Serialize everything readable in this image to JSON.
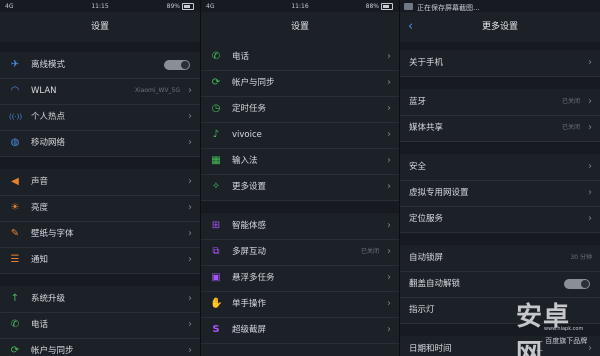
{
  "panel1": {
    "status": {
      "left": "4G",
      "time": "11:15",
      "battery": "89%"
    },
    "title": "设置",
    "items": [
      {
        "label": "离线模式",
        "icon": "airplane-icon",
        "color": "#4a90e2",
        "glyph": "✈"
      },
      {
        "label": "WLAN",
        "value": "Xiaomi_WV_5G",
        "icon": "wifi-icon",
        "color": "#4a90e2",
        "glyph": "◠"
      },
      {
        "label": "个人热点",
        "icon": "hotspot-icon",
        "color": "#4a90e2",
        "glyph": "((·))"
      },
      {
        "label": "移动网络",
        "icon": "globe-icon",
        "color": "#4a90e2",
        "glyph": "◍"
      },
      {
        "label": "声音",
        "icon": "speaker-icon",
        "color": "#e8812f",
        "glyph": "◀"
      },
      {
        "label": "亮度",
        "icon": "brightness-icon",
        "color": "#e8812f",
        "glyph": "☀"
      },
      {
        "label": "壁纸与字体",
        "icon": "brush-icon",
        "color": "#e8812f",
        "glyph": "✎"
      },
      {
        "label": "通知",
        "icon": "notification-icon",
        "color": "#e8812f",
        "glyph": "☰"
      },
      {
        "label": "系统升级",
        "icon": "upgrade-icon",
        "color": "#45c05a",
        "glyph": "↑"
      },
      {
        "label": "电话",
        "icon": "phone-icon",
        "color": "#45c05a",
        "glyph": "✆"
      },
      {
        "label": "帐户与同步",
        "icon": "account-icon",
        "color": "#45c05a",
        "glyph": "⟳"
      }
    ]
  },
  "panel2": {
    "status": {
      "left": "4G",
      "time": "11:16",
      "battery": "88%"
    },
    "title": "设置",
    "items": [
      {
        "label": "电话",
        "icon": "phone-icon",
        "color": "#45c05a",
        "glyph": "✆"
      },
      {
        "label": "帐户与同步",
        "icon": "account-icon",
        "color": "#45c05a",
        "glyph": "⟳"
      },
      {
        "label": "定时任务",
        "icon": "timer-icon",
        "color": "#45c05a",
        "glyph": "◷"
      },
      {
        "label": "vivoice",
        "icon": "microphone-icon",
        "color": "#45c05a",
        "glyph": "♪"
      },
      {
        "label": "输入法",
        "icon": "keyboard-icon",
        "color": "#45c05a",
        "glyph": "▦"
      },
      {
        "label": "更多设置",
        "icon": "wrench-icon",
        "color": "#45c05a",
        "glyph": "✧"
      },
      {
        "label": "智能体感",
        "icon": "smart-motion-icon",
        "color": "#a855f7",
        "glyph": "⊞"
      },
      {
        "label": "多屏互动",
        "value": "已关闭",
        "icon": "multiscreen-icon",
        "color": "#a855f7",
        "glyph": "⧉"
      },
      {
        "label": "悬浮多任务",
        "icon": "floating-task-icon",
        "color": "#a855f7",
        "glyph": "▣"
      },
      {
        "label": "单手操作",
        "icon": "one-hand-icon",
        "color": "#a855f7",
        "glyph": "✋"
      },
      {
        "label": "超级截屏",
        "icon": "screenshot-icon",
        "color": "#a855f7",
        "glyph": "S"
      }
    ]
  },
  "panel3": {
    "notification": "正在保存屏幕截图...",
    "title": "更多设置",
    "items": [
      {
        "label": "关于手机"
      },
      {
        "label": "蓝牙",
        "value": "已关闭"
      },
      {
        "label": "媒体共享",
        "value": "已关闭"
      },
      {
        "label": "安全"
      },
      {
        "label": "虚拟专用网设置"
      },
      {
        "label": "定位服务"
      },
      {
        "label": "自动锁屏",
        "value": "30 分钟"
      },
      {
        "label": "翻盖自动解锁"
      },
      {
        "label": "指示灯"
      },
      {
        "label": "日期和时间"
      }
    ]
  },
  "watermark": {
    "logo": "安卓网",
    "site": "www.hiapk.com",
    "brand": "— 百度旗下品牌 —"
  }
}
